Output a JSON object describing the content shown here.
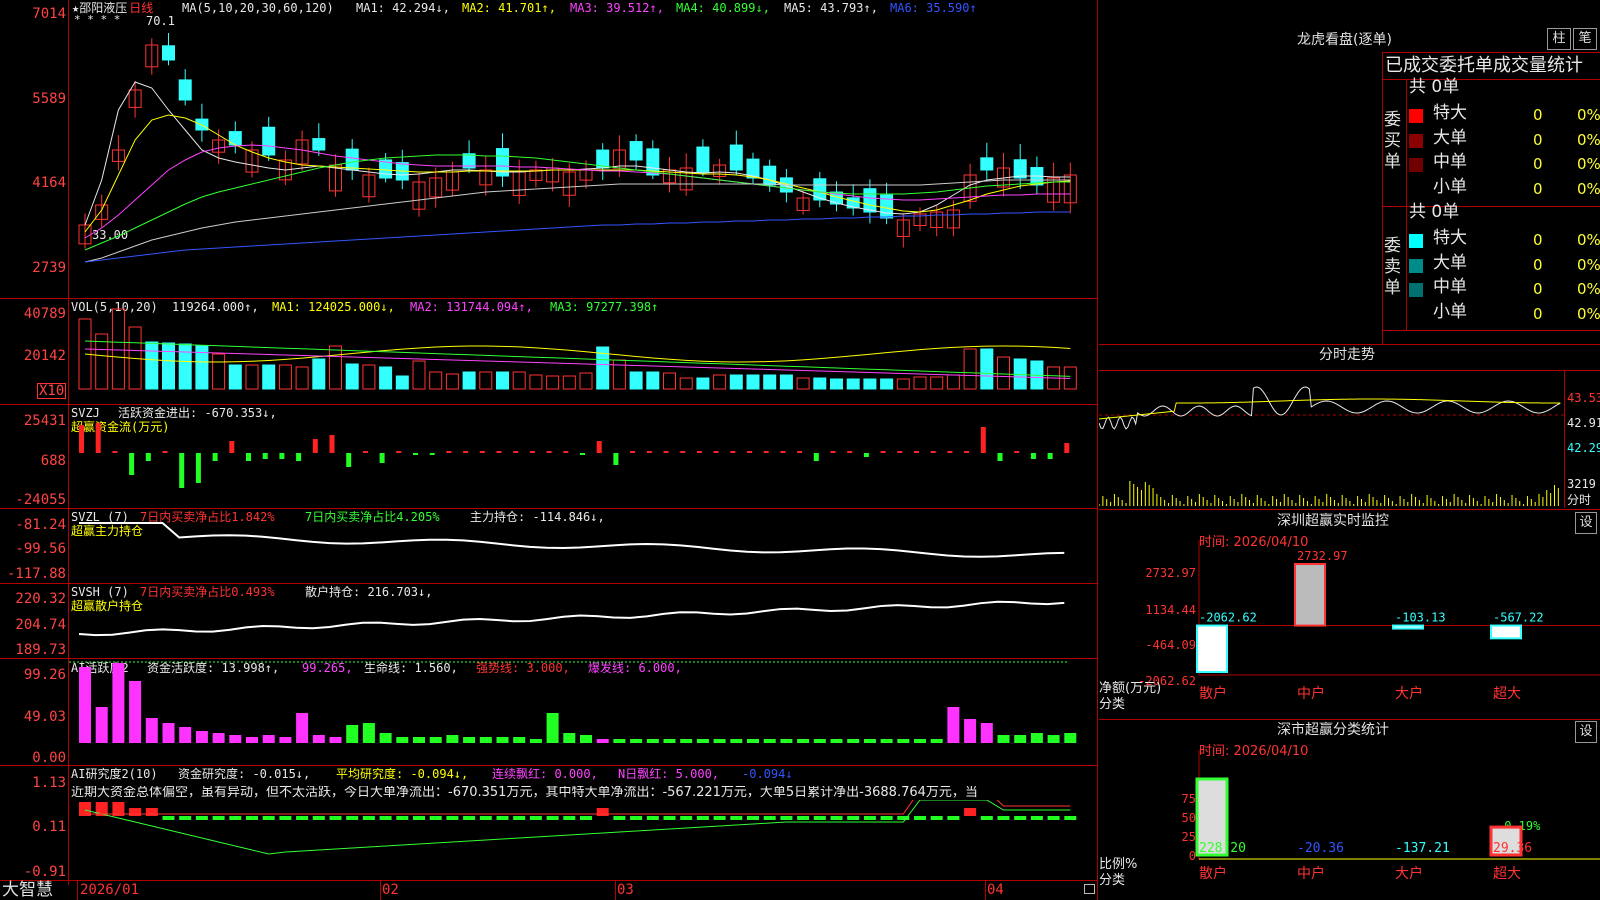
{
  "app": {
    "brand": "大智慧"
  },
  "kline": {
    "title": "★邵阳液压",
    "period": "日线",
    "ma_label": "MA(5,10,20,30,60,120)",
    "ma1": "MA1: 42.294↓,",
    "ma2": "MA2: 41.701↑,",
    "ma3": "MA3: 39.512↑,",
    "ma4": "MA4: 40.899↓,",
    "ma5": "MA5: 43.793↑,",
    "ma6": "MA6: 35.590↑",
    "y_labels": [
      "7014",
      "5589",
      "4164",
      "2739"
    ],
    "high_mark": "70.1",
    "low_mark": "33.00",
    "stars": "* * * *"
  },
  "vol": {
    "label": "VOL(5,10,20)",
    "value": "119264.000↑,",
    "ma1": "MA1: 124025.000↓,",
    "ma2": "MA2: 131744.094↑,",
    "ma3": "MA3: 97277.398↑",
    "y_labels": [
      "40789",
      "20142"
    ],
    "unit": "X10"
  },
  "svzj": {
    "label": "SVZJ",
    "text": "活跃资金进出: -670.353↓,",
    "sub": "超赢资金流(万元)",
    "y_labels": [
      "25431",
      "688",
      "-24055"
    ]
  },
  "svzl": {
    "label": "SVZL (7)",
    "t1": "7日内买卖净占比1.842%",
    "t2": "7日内买卖净占比4.205%",
    "t3": "主力持仓: -114.846↓,",
    "sub": "超赢主力持仓",
    "y_labels": [
      "-81.24",
      "-99.56",
      "-117.88"
    ]
  },
  "svsh": {
    "label": "SVSH (7)",
    "t1": "7日内买卖净占比0.493%",
    "t2": "散户持仓: 216.703↓,",
    "sub": "超赢散户持仓",
    "y_labels": [
      "220.32",
      "204.74",
      "189.73"
    ]
  },
  "ai_active": {
    "label": "AI活跃度2",
    "t1": "资金活跃度: 13.998↑,",
    "t2": "99.265,",
    "t3": "生命线: 1.560,",
    "t4": "强势线: 3.000,",
    "t5": "爆发线: 6.000,",
    "y_labels": [
      "99.26",
      "49.03",
      "0.00"
    ]
  },
  "ai_research": {
    "label": "AI研究度2(10)",
    "t1": "资金研究度: -0.015↓,",
    "t2": "平均研究度: -0.094↓,",
    "t3": "连续飘红: 0.000,",
    "t4": "N日飘红: 5.000,",
    "t5": "-0.094↓",
    "comment": "近期大资金总体偏空，虽有异动，但不太活跃，今日大单净流出：-670.351万元，其中特大单净流出：-567.221万元，大单5日累计净出-3688.764万元，当",
    "y_labels": [
      "1.13",
      "0.11",
      "-0.91"
    ]
  },
  "xaxis": {
    "labels": [
      "2026/01",
      "02",
      "03",
      "04"
    ]
  },
  "dragon": {
    "title": "龙虎看盘(逐单)",
    "btn1": "柱",
    "btn2": "笔",
    "header": "已成交委托单成交量统计",
    "buy": {
      "side": "委买单",
      "total": "共 0单",
      "rows": [
        {
          "name": "特大",
          "count": "0",
          "pct": "0%",
          "color": "#ff0000"
        },
        {
          "name": "大单",
          "count": "0",
          "pct": "0%",
          "color": "#8b0000"
        },
        {
          "name": "中单",
          "count": "0",
          "pct": "0%",
          "color": "#700000"
        },
        {
          "name": "小单",
          "count": "0",
          "pct": "0%",
          "color": ""
        }
      ]
    },
    "sell": {
      "side": "委卖单",
      "total": "共 0单",
      "rows": [
        {
          "name": "特大",
          "count": "0",
          "pct": "0%",
          "color": "#00ffff"
        },
        {
          "name": "大单",
          "count": "0",
          "pct": "0%",
          "color": "#008b8b"
        },
        {
          "name": "中单",
          "count": "0",
          "pct": "0%",
          "color": "#007070"
        },
        {
          "name": "小单",
          "count": "0",
          "pct": "0%",
          "color": ""
        }
      ]
    }
  },
  "intraday": {
    "title": "分时走势",
    "prices": [
      "43.53",
      "42.91",
      "42.29"
    ],
    "vol": "3219",
    "vol_unit": "分时"
  },
  "monitor": {
    "title": "深圳超赢实时监控",
    "btn": "设",
    "time": "时间: 2026/04/10",
    "y_labels": [
      "2732.97",
      "1134.44",
      "-464.09",
      "-2062.62"
    ],
    "unit_top": "净额(万元)",
    "unit_bot": "分类",
    "bars": [
      {
        "cat": "散户",
        "value": -2062.62,
        "label": "-2062.62"
      },
      {
        "cat": "中户",
        "value": 2732.97,
        "label": "2732.97"
      },
      {
        "cat": "大户",
        "value": -103.13,
        "label": "-103.13"
      },
      {
        "cat": "超大",
        "value": -567.22,
        "label": "-567.22"
      }
    ]
  },
  "classify": {
    "title": "深市超赢分类统计",
    "btn": "设",
    "time": "时间: 2026/04/10",
    "y_labels": [
      "75",
      "50",
      "25",
      "0"
    ],
    "unit_top": "比例%",
    "unit_bot": "分类",
    "top_label": "-0.19%",
    "bars": [
      {
        "cat": "散户",
        "value": 228.2,
        "label": "228.20"
      },
      {
        "cat": "中户",
        "value": -20.36,
        "label": "-20.36"
      },
      {
        "cat": "大户",
        "value": -137.21,
        "label": "-137.21"
      },
      {
        "cat": "超大",
        "value": 29.36,
        "label": "29.36"
      }
    ]
  },
  "colors": {
    "up": "#ff3333",
    "down": "#33ffff",
    "grid": "#b00000",
    "bg": "#000000"
  }
}
